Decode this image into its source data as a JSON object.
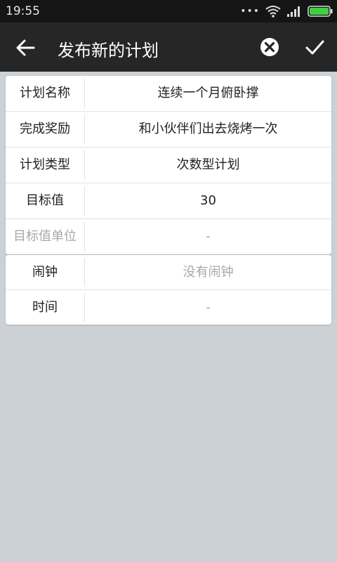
{
  "status_bar": {
    "time": "19:55"
  },
  "header": {
    "title": "发布新的计划"
  },
  "form": {
    "rows": [
      {
        "label": "计划名称",
        "value": "连续一个月俯卧撑"
      },
      {
        "label": "完成奖励",
        "value": "和小伙伴们出去烧烤一次"
      },
      {
        "label": "计划类型",
        "value": "次数型计划"
      },
      {
        "label": "目标值",
        "value": "30"
      },
      {
        "label": "目标值单位",
        "value": "-"
      }
    ]
  },
  "alarm": {
    "rows": [
      {
        "label": "闹钟",
        "value": "没有闹钟"
      },
      {
        "label": "时间",
        "value": "-"
      }
    ]
  },
  "colors": {
    "app_bar": "#262626",
    "status_bar": "#151515",
    "background": "#ccd1d5",
    "muted_text": "#a8a8a8",
    "battery": "#3ed13e"
  }
}
